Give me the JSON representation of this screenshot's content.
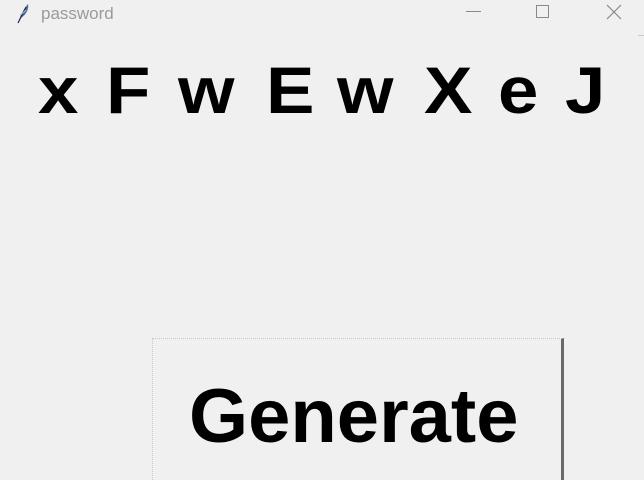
{
  "window": {
    "title": "password",
    "icon": "feather-icon",
    "controls": {
      "minimize_icon": "minimize-icon",
      "maximize_icon": "maximize-icon",
      "close_icon": "close-icon"
    }
  },
  "password": {
    "chars": [
      "x",
      "F",
      "w",
      "E",
      "w",
      "X",
      "e",
      "J"
    ]
  },
  "actions": {
    "generate_label": "Generate"
  },
  "colors": {
    "background": "#f0f0f0",
    "title_text": "#9a9a9a",
    "text": "#000000"
  }
}
